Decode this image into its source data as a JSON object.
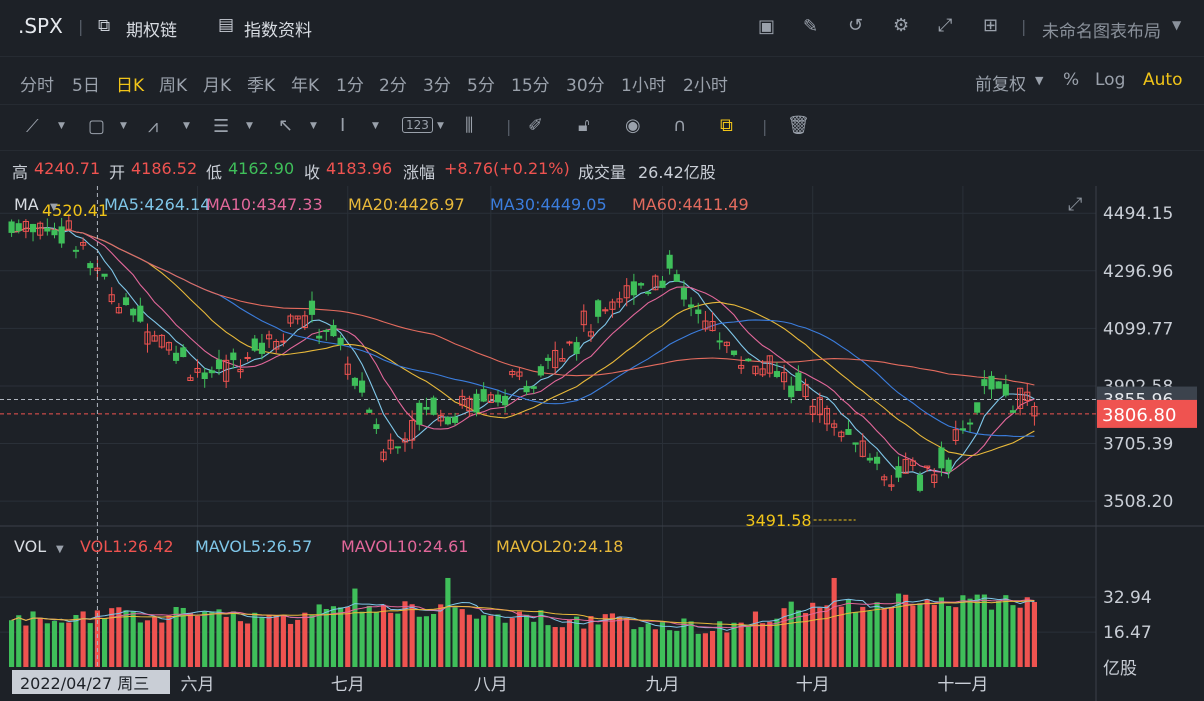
{
  "header": {
    "symbol": ".SPX",
    "options_chain": "期权链",
    "index_info": "指数资料",
    "layout_name": "未命名图表布局"
  },
  "periods": [
    "分时",
    "5日",
    "日K",
    "周K",
    "月K",
    "季K",
    "年K",
    "1分",
    "2分",
    "3分",
    "5分",
    "15分",
    "30分",
    "1小时",
    "2小时"
  ],
  "active_period": "日K",
  "adjust": {
    "mode": "前复权",
    "percent": "%",
    "log": "Log",
    "auto": "Auto"
  },
  "ohlc": {
    "high_label": "高",
    "high": "4240.71",
    "open_label": "开",
    "open": "4186.52",
    "low_label": "低",
    "low": "4162.90",
    "close_label": "收",
    "close": "4183.96",
    "change_label": "涨幅",
    "change": "+8.76(+0.21%)",
    "volume_label": "成交量",
    "volume": "26.42亿股"
  },
  "ma_legend": {
    "label": "MA",
    "ma5": "MA5:4264.14",
    "ma10": "MA10:4347.33",
    "ma20": "MA20:4426.97",
    "ma30": "MA30:4449.05",
    "ma60": "MA60:4411.49"
  },
  "vol_legend": {
    "label": "VOL",
    "vol1": "VOL1:26.42",
    "mavol5": "MAVOL5:26.57",
    "mavol10": "MAVOL10:24.61",
    "mavol20": "MAVOL20:24.18"
  },
  "colors": {
    "up": "#ef5350",
    "down": "#3fbf5a",
    "ma5": "#7fc6e8",
    "ma10": "#e2679a",
    "ma20": "#e8b93a",
    "ma30": "#3b7ddd",
    "ma60": "#e36b5e",
    "accent": "#f0c419"
  },
  "chart_data": {
    "type": "candlestick",
    "price_ticks": [
      "4494.15",
      "4296.96",
      "4099.77",
      "3902.58",
      "3705.39",
      "3508.20"
    ],
    "price_tick_values": [
      4494.15,
      4296.96,
      4099.77,
      3902.58,
      3705.39,
      3508.2
    ],
    "ylim": [
      3440,
      4560
    ],
    "last_price_label": "3806.80",
    "last_price": 3806.8,
    "crosshair_price_label": "3855.96",
    "crosshair_price": 3855.96,
    "max_marker": "4520.41",
    "min_marker": "3491.58",
    "volume_ticks": [
      "32.94",
      "16.47",
      "亿股"
    ],
    "volume_tick_values": [
      32.94,
      16.47
    ],
    "volume_ylim": [
      0,
      50
    ],
    "months": [
      "六月",
      "七月",
      "八月",
      "九月",
      "十月",
      "十一月"
    ],
    "month_positions": [
      26,
      47,
      67,
      91,
      112,
      133
    ],
    "cursor_date": "2022/04/27 周三",
    "bar_count": 144,
    "anchors": [
      [
        0,
        4460
      ],
      [
        8,
        4440
      ],
      [
        14,
        4220
      ],
      [
        22,
        4050
      ],
      [
        28,
        3920
      ],
      [
        34,
        4030
      ],
      [
        40,
        4140
      ],
      [
        44,
        4120
      ],
      [
        48,
        3930
      ],
      [
        52,
        3680
      ],
      [
        58,
        3830
      ],
      [
        64,
        3840
      ],
      [
        72,
        3900
      ],
      [
        76,
        4030
      ],
      [
        82,
        4130
      ],
      [
        88,
        4260
      ],
      [
        92,
        4290
      ],
      [
        96,
        4140
      ],
      [
        100,
        4040
      ],
      [
        104,
        3970
      ],
      [
        110,
        3900
      ],
      [
        116,
        3740
      ],
      [
        122,
        3620
      ],
      [
        128,
        3590
      ],
      [
        132,
        3700
      ],
      [
        136,
        3900
      ],
      [
        140,
        3870
      ],
      [
        143,
        3810
      ]
    ],
    "volume_anchors": [
      [
        0,
        22
      ],
      [
        20,
        25
      ],
      [
        40,
        24
      ],
      [
        50,
        30
      ],
      [
        60,
        26
      ],
      [
        80,
        22
      ],
      [
        100,
        19
      ],
      [
        110,
        28
      ],
      [
        120,
        30
      ],
      [
        130,
        32
      ],
      [
        143,
        30
      ]
    ]
  }
}
